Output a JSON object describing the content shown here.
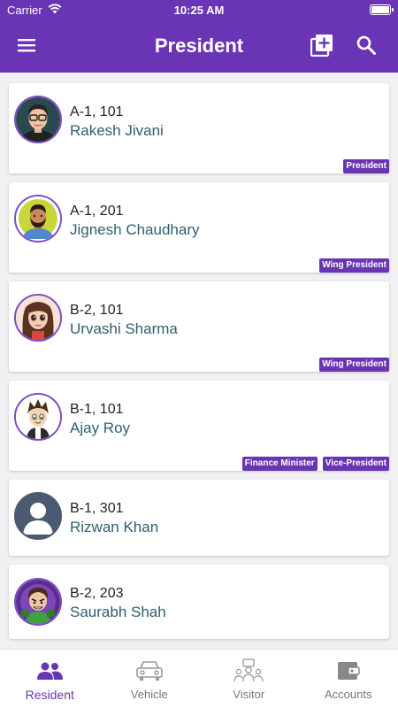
{
  "status_bar": {
    "carrier": "Carrier",
    "time": "10:25 AM"
  },
  "header": {
    "title": "President",
    "icons": [
      "menu-icon",
      "add-box-icon",
      "search-icon"
    ]
  },
  "residents": [
    {
      "flat": "A-1, 101",
      "name": "Rakesh Jivani",
      "roles": [
        "President"
      ]
    },
    {
      "flat": "A-1, 201",
      "name": "Jignesh Chaudhary",
      "roles": [
        "Wing President"
      ]
    },
    {
      "flat": "B-2, 101",
      "name": "Urvashi Sharma",
      "roles": [
        "Wing President"
      ]
    },
    {
      "flat": "B-1, 101",
      "name": "Ajay Roy",
      "roles": [
        "Finance Minister",
        "Vice-President"
      ]
    },
    {
      "flat": "B-1, 301",
      "name": "Rizwan Khan",
      "roles": []
    },
    {
      "flat": "B-2, 203",
      "name": "Saurabh Shah",
      "roles": []
    }
  ],
  "tabs": [
    {
      "label": "Resident",
      "icon": "people-icon",
      "active": true
    },
    {
      "label": "Vehicle",
      "icon": "car-icon",
      "active": false
    },
    {
      "label": "Visitor",
      "icon": "visitor-icon",
      "active": false
    },
    {
      "label": "Accounts",
      "icon": "wallet-icon",
      "active": false
    }
  ],
  "colors": {
    "primary": "#6a35b4",
    "name_text": "#2f5f6d",
    "background": "#f1f1f3"
  }
}
